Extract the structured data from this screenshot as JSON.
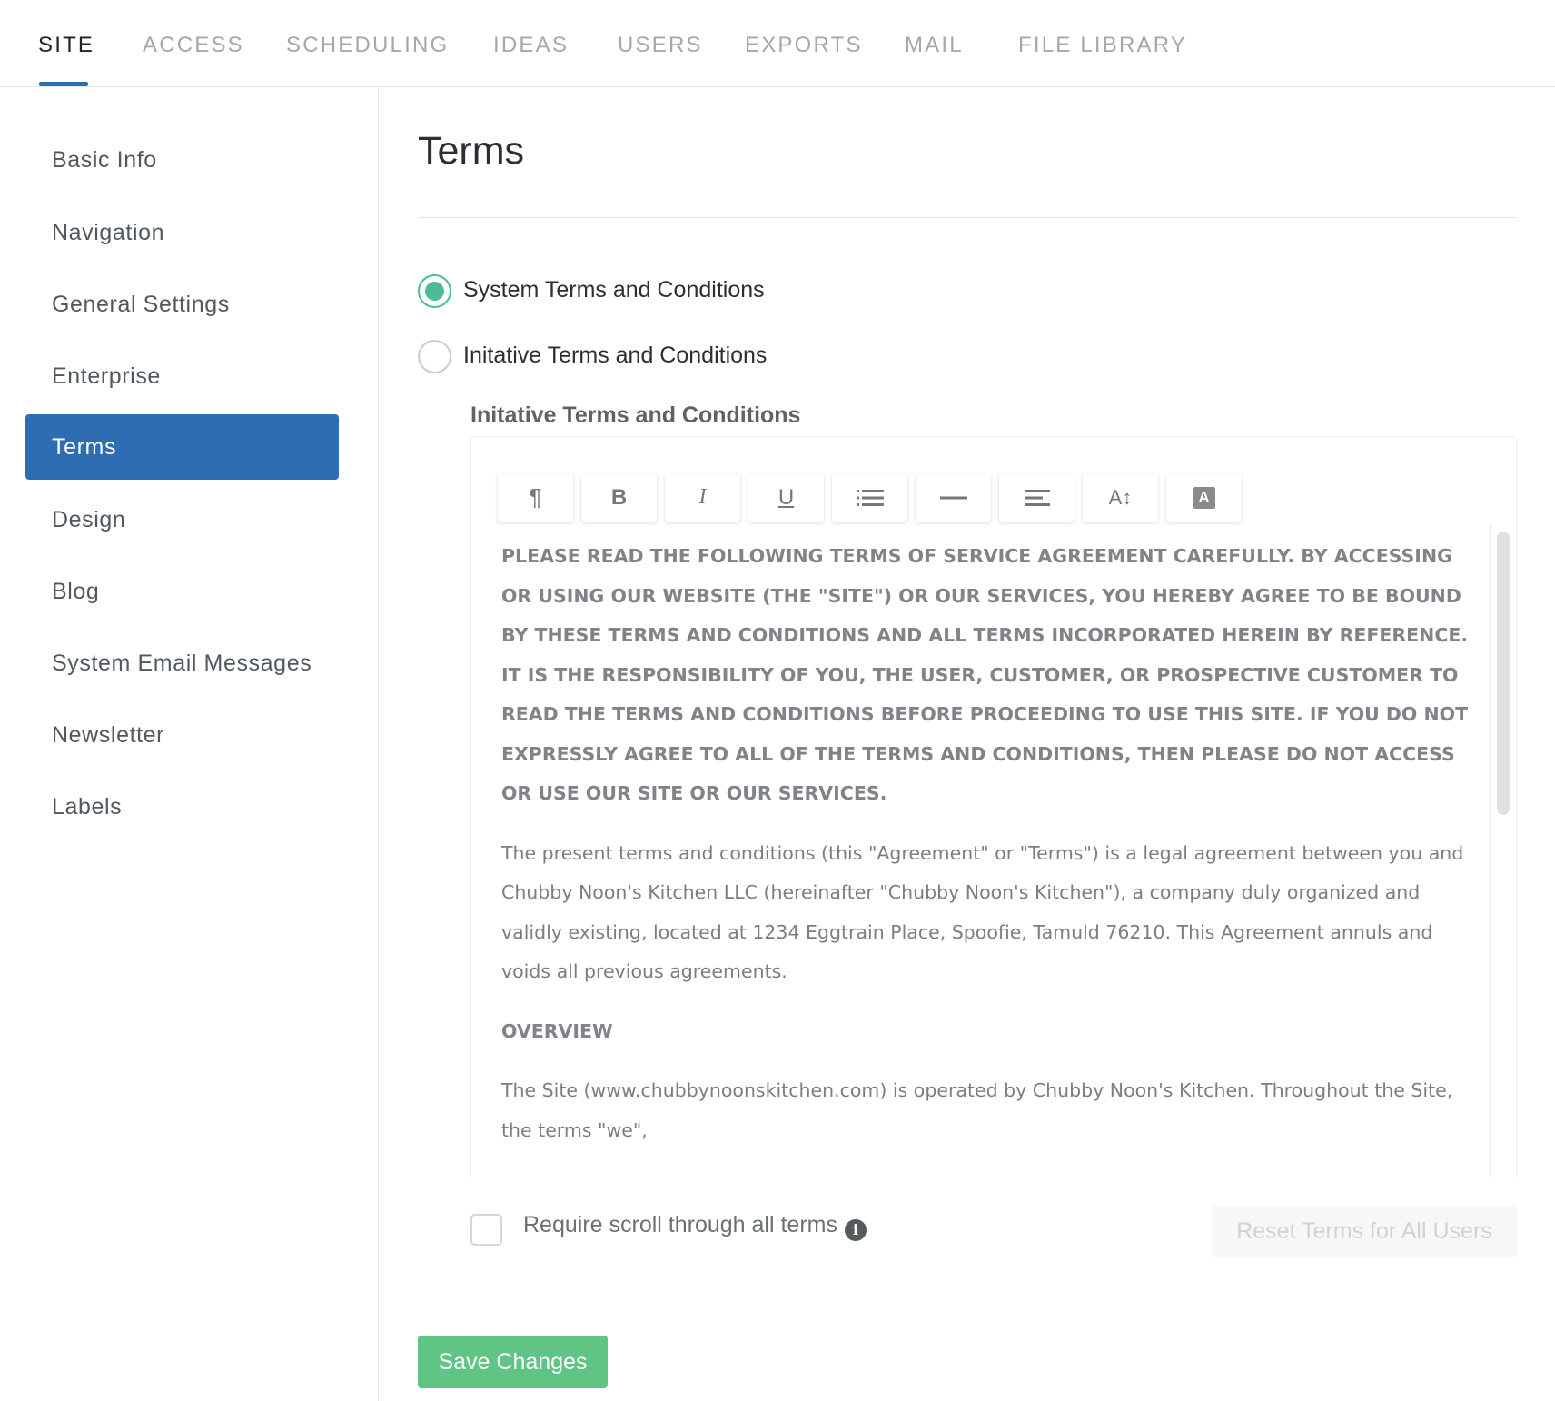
{
  "tabs": [
    {
      "label": "SITE",
      "active": true
    },
    {
      "label": "ACCESS"
    },
    {
      "label": "SCHEDULING"
    },
    {
      "label": "IDEAS"
    },
    {
      "label": "USERS"
    },
    {
      "label": "EXPORTS"
    },
    {
      "label": "MAIL"
    },
    {
      "label": "FILE LIBRARY"
    }
  ],
  "sidebar": {
    "items": [
      {
        "label": "Basic Info"
      },
      {
        "label": "Navigation"
      },
      {
        "label": "General Settings"
      },
      {
        "label": "Enterprise"
      },
      {
        "label": "Terms",
        "active": true
      },
      {
        "label": "Design"
      },
      {
        "label": "Blog"
      },
      {
        "label": "System Email Messages"
      },
      {
        "label": "Newsletter"
      },
      {
        "label": "Labels"
      }
    ]
  },
  "main": {
    "title": "Terms",
    "options": [
      {
        "label": "System Terms and Conditions",
        "selected": true
      },
      {
        "label": "Initative Terms and Conditions",
        "selected": false
      }
    ],
    "editor_heading": "Initative Terms and Conditions",
    "toolbar": [
      {
        "icon": "paragraph-icon",
        "glyph": "¶"
      },
      {
        "icon": "bold-icon",
        "glyph": "B"
      },
      {
        "icon": "italic-icon",
        "glyph": "I"
      },
      {
        "icon": "underline-icon",
        "glyph": "U"
      },
      {
        "icon": "list-icon"
      },
      {
        "icon": "horizontal-rule-icon"
      },
      {
        "icon": "align-icon"
      },
      {
        "icon": "font-size-icon",
        "glyph": "A↕"
      },
      {
        "icon": "font-color-icon",
        "glyph": "A"
      }
    ],
    "content": {
      "caps_paragraph": "PLEASE READ THE FOLLOWING TERMS OF SERVICE AGREEMENT CAREFULLY. BY ACCESSING OR USING OUR WEBSITE (THE \"SITE\") OR OUR SERVICES, YOU HEREBY AGREE TO BE BOUND BY THESE TERMS AND CONDITIONS AND ALL TERMS INCORPORATED HEREIN BY REFERENCE. IT IS THE RESPONSIBILITY OF YOU, THE USER, CUSTOMER, OR PROSPECTIVE CUSTOMER TO READ THE TERMS AND CONDITIONS BEFORE PROCEEDING TO USE THIS SITE. IF YOU DO NOT EXPRESSLY AGREE TO ALL OF THE TERMS AND CONDITIONS, THEN PLEASE DO NOT ACCESS OR USE OUR SITE OR OUR SERVICES.",
      "paragraph_1": "The present terms and conditions (this \"Agreement\" or \"Terms\") is a legal agreement between you and Chubby Noon's Kitchen LLC (hereinafter \"Chubby Noon's Kitchen\"), a company duly organized and validly existing, located at 1234 Eggtrain Place, Spoofie, Tamuld 76210. This Agreement annuls and voids all previous agreements.",
      "overview_heading": "OVERVIEW",
      "paragraph_2": "The Site (www.chubbynoonskitchen.com) is operated by Chubby Noon's Kitchen. Throughout the Site, the terms \"we\","
    },
    "require_scroll_label": "Require scroll through all terms",
    "info_icon_glyph": "i",
    "reset_button": "Reset Terms for All Users",
    "save_button": "Save Changes"
  },
  "colors": {
    "accent_blue": "#2e6db4",
    "radio_green": "#4dbb95",
    "save_green": "#5fc484"
  }
}
